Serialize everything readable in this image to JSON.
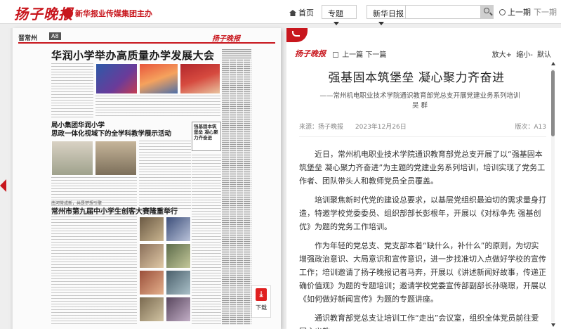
{
  "topbar": {
    "logo": "扬子晚报",
    "sublogo": "新华报业传媒集团主办",
    "home_label": "首页",
    "topic_label": "专题",
    "xinhua_label": "新华日报",
    "search_value": "",
    "prev_label": "上一期",
    "next_label": "下一期"
  },
  "newspaper": {
    "section": "晋常州",
    "page": "A8",
    "logo": "扬子晚报",
    "headline": "华润小学举办高质量办学发展大会",
    "sub_headline_1": "局小集团华润小学",
    "sub_headline_2": "思政一体化视域下的全学科教学展示活动",
    "box_text": "强基固本筑堡垒 凝心聚力齐奋进",
    "label_small": "南河常成新，共是梦想引擎",
    "headline_3": "常州市第九届中小学生创客大赛隆重举行",
    "download_label": "下载",
    "pdf_glyph": "⤓"
  },
  "article": {
    "logo": "扬子晚报",
    "nav_prev": "上一篇",
    "nav_next": "下一篇",
    "font_larger": "放大+",
    "font_smaller": "缩小-",
    "font_default": "默认",
    "title": "强基固本筑堡垒 凝心聚力齐奋进",
    "subtitle": "——常州机电职业技术学院通识教育部党总支开展党建业务系列培训",
    "author": "吴 群",
    "source": "来源：扬子晚报",
    "date": "2023年12月26日",
    "page": "版次：A13",
    "paragraphs": [
      "近日，常州机电职业技术学院通识教育部党总支开展了以“强基固本筑堡垒 凝心聚力齐奋进”为主题的党建业务系列培训，培训实现了党务工作者、团队带头人和教师党员全员覆盖。",
      "培训聚焦新时代党的建设总要求，以基层党组织最迫切的需求量身打造，特邀学校党委委员、组织部部长彭根年，开展以《对标争先 强基创优》为题的党务工作培训。",
      "作为年轻的党总支、党支部本着“缺什么，补什么”的原则，为切实增强政治意识、大局意识和宣传意识，进一步找准切入点做好学校的宣传工作；培训邀请了扬子晚报记者马奔，开展以《讲述新闻好故事，传递正确价值观》为题的专题培训；邀请学校党委宣传部副部长孙晓璟，开展以《如何做好新闻宣传》为题的专题讲座。",
      "通识教育部党总支让培训工作“走出”会议室，组织全体党员前往爱国主义教"
    ]
  },
  "colors": {
    "brand_red": "#c8161d",
    "body_text": "#333333"
  }
}
